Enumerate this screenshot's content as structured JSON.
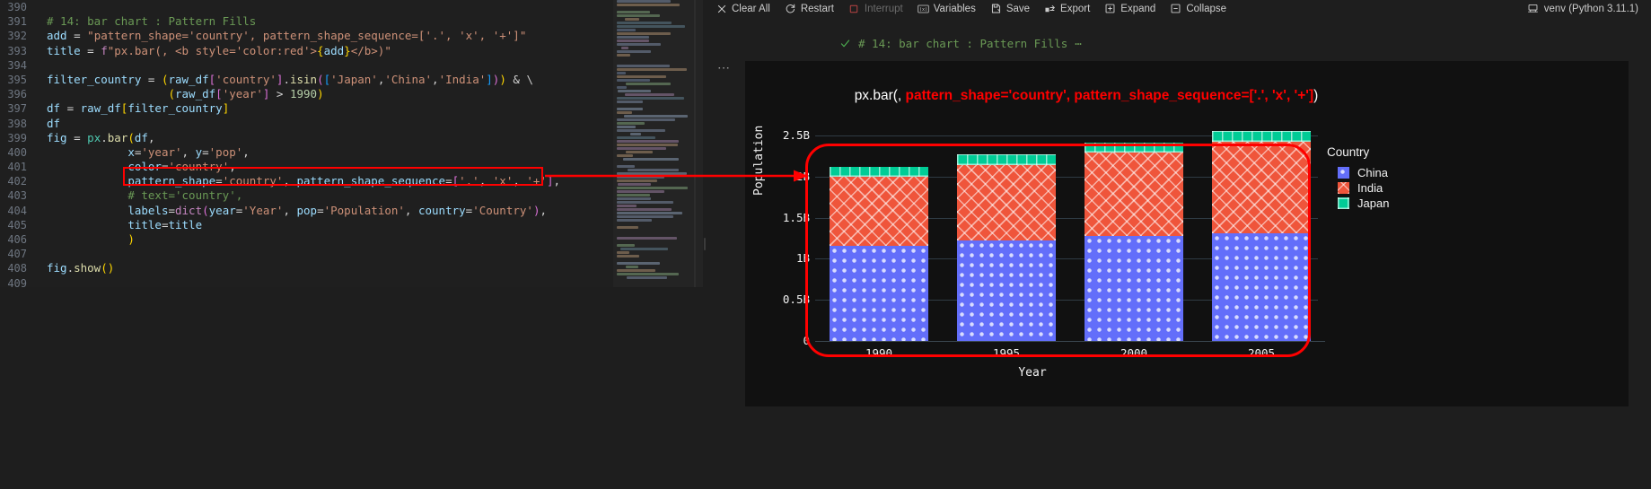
{
  "editor": {
    "lines": [
      {
        "num": "390",
        "tokens": []
      },
      {
        "num": "391",
        "tokens": [
          {
            "t": "# 14: bar chart : Pattern Fills",
            "c": "tk-com"
          }
        ]
      },
      {
        "num": "392",
        "tokens": [
          {
            "t": "add ",
            "c": "tk-var"
          },
          {
            "t": "= ",
            "c": "tk-op"
          },
          {
            "t": "\"pattern_shape='country', pattern_shape_sequence=['.', 'x', '+']\"",
            "c": "tk-str"
          }
        ]
      },
      {
        "num": "393",
        "tokens": [
          {
            "t": "title ",
            "c": "tk-var"
          },
          {
            "t": "= ",
            "c": "tk-op"
          },
          {
            "t": "f",
            "c": "tk-kw"
          },
          {
            "t": "\"px.bar(, <b style='color:red'>",
            "c": "tk-str"
          },
          {
            "t": "{",
            "c": "tk-brk1"
          },
          {
            "t": "add",
            "c": "tk-var"
          },
          {
            "t": "}",
            "c": "tk-brk1"
          },
          {
            "t": "</b>)\"",
            "c": "tk-str"
          }
        ]
      },
      {
        "num": "394",
        "tokens": []
      },
      {
        "num": "395",
        "tokens": [
          {
            "t": "filter_country ",
            "c": "tk-var"
          },
          {
            "t": "= ",
            "c": "tk-op"
          },
          {
            "t": "(",
            "c": "tk-brk1"
          },
          {
            "t": "raw_df",
            "c": "tk-var"
          },
          {
            "t": "[",
            "c": "tk-brk2"
          },
          {
            "t": "'country'",
            "c": "tk-str"
          },
          {
            "t": "]",
            "c": "tk-brk2"
          },
          {
            "t": ".",
            "c": "tk-op"
          },
          {
            "t": "isin",
            "c": "tk-fn"
          },
          {
            "t": "(",
            "c": "tk-brk2"
          },
          {
            "t": "[",
            "c": "tk-brk3"
          },
          {
            "t": "'Japan'",
            "c": "tk-str"
          },
          {
            "t": ",",
            "c": "tk-op"
          },
          {
            "t": "'China'",
            "c": "tk-str"
          },
          {
            "t": ",",
            "c": "tk-op"
          },
          {
            "t": "'India'",
            "c": "tk-str"
          },
          {
            "t": "]",
            "c": "tk-brk3"
          },
          {
            "t": ")",
            "c": "tk-brk2"
          },
          {
            "t": ")",
            "c": "tk-brk1"
          },
          {
            "t": " & ",
            "c": "tk-op"
          },
          {
            "t": "\\",
            "c": "tk-plain"
          }
        ]
      },
      {
        "num": "396",
        "tokens": [
          {
            "t": "                  ",
            "c": "tk-plain"
          },
          {
            "t": "(",
            "c": "tk-brk1"
          },
          {
            "t": "raw_df",
            "c": "tk-var"
          },
          {
            "t": "[",
            "c": "tk-brk2"
          },
          {
            "t": "'year'",
            "c": "tk-str"
          },
          {
            "t": "]",
            "c": "tk-brk2"
          },
          {
            "t": " > ",
            "c": "tk-op"
          },
          {
            "t": "1990",
            "c": "tk-num"
          },
          {
            "t": ")",
            "c": "tk-brk1"
          }
        ]
      },
      {
        "num": "397",
        "tokens": [
          {
            "t": "df ",
            "c": "tk-var"
          },
          {
            "t": "= ",
            "c": "tk-op"
          },
          {
            "t": "raw_df",
            "c": "tk-var"
          },
          {
            "t": "[",
            "c": "tk-brk1"
          },
          {
            "t": "filter_country",
            "c": "tk-var"
          },
          {
            "t": "]",
            "c": "tk-brk1"
          }
        ]
      },
      {
        "num": "398",
        "tokens": [
          {
            "t": "df",
            "c": "tk-var"
          }
        ]
      },
      {
        "num": "399",
        "tokens": [
          {
            "t": "fig ",
            "c": "tk-var"
          },
          {
            "t": "= ",
            "c": "tk-op"
          },
          {
            "t": "px",
            "c": "tk-obj"
          },
          {
            "t": ".",
            "c": "tk-op"
          },
          {
            "t": "bar",
            "c": "tk-fn"
          },
          {
            "t": "(",
            "c": "tk-brk1"
          },
          {
            "t": "df",
            "c": "tk-var"
          },
          {
            "t": ",",
            "c": "tk-op"
          }
        ]
      },
      {
        "num": "400",
        "tokens": [
          {
            "t": "            ",
            "c": "tk-plain"
          },
          {
            "t": "x",
            "c": "tk-var"
          },
          {
            "t": "=",
            "c": "tk-op"
          },
          {
            "t": "'year'",
            "c": "tk-str"
          },
          {
            "t": ", ",
            "c": "tk-op"
          },
          {
            "t": "y",
            "c": "tk-var"
          },
          {
            "t": "=",
            "c": "tk-op"
          },
          {
            "t": "'pop'",
            "c": "tk-str"
          },
          {
            "t": ",",
            "c": "tk-op"
          }
        ]
      },
      {
        "num": "401",
        "tokens": [
          {
            "t": "            ",
            "c": "tk-plain"
          },
          {
            "t": "color",
            "c": "tk-var"
          },
          {
            "t": "=",
            "c": "tk-op"
          },
          {
            "t": "'country'",
            "c": "tk-str"
          },
          {
            "t": ",",
            "c": "tk-op"
          }
        ]
      },
      {
        "num": "402",
        "tokens": [
          {
            "t": "            ",
            "c": "tk-plain"
          },
          {
            "t": "pattern_shape",
            "c": "tk-var"
          },
          {
            "t": "=",
            "c": "tk-op"
          },
          {
            "t": "'country'",
            "c": "tk-str"
          },
          {
            "t": ", ",
            "c": "tk-op"
          },
          {
            "t": "pattern_shape_sequence",
            "c": "tk-var"
          },
          {
            "t": "=",
            "c": "tk-op"
          },
          {
            "t": "[",
            "c": "tk-brk2"
          },
          {
            "t": "'.'",
            "c": "tk-str"
          },
          {
            "t": ", ",
            "c": "tk-op"
          },
          {
            "t": "'x'",
            "c": "tk-str"
          },
          {
            "t": ", ",
            "c": "tk-op"
          },
          {
            "t": "'+'",
            "c": "tk-str"
          },
          {
            "t": "]",
            "c": "tk-brk2"
          },
          {
            "t": ",",
            "c": "tk-op"
          }
        ]
      },
      {
        "num": "403",
        "tokens": [
          {
            "t": "            ",
            "c": "tk-plain"
          },
          {
            "t": "# text='country',",
            "c": "tk-com"
          }
        ]
      },
      {
        "num": "404",
        "tokens": [
          {
            "t": "            ",
            "c": "tk-plain"
          },
          {
            "t": "labels",
            "c": "tk-var"
          },
          {
            "t": "=",
            "c": "tk-op"
          },
          {
            "t": "dict",
            "c": "tk-kw"
          },
          {
            "t": "(",
            "c": "tk-brk2"
          },
          {
            "t": "year",
            "c": "tk-var"
          },
          {
            "t": "=",
            "c": "tk-op"
          },
          {
            "t": "'Year'",
            "c": "tk-str"
          },
          {
            "t": ", ",
            "c": "tk-op"
          },
          {
            "t": "pop",
            "c": "tk-var"
          },
          {
            "t": "=",
            "c": "tk-op"
          },
          {
            "t": "'Population'",
            "c": "tk-str"
          },
          {
            "t": ", ",
            "c": "tk-op"
          },
          {
            "t": "country",
            "c": "tk-var"
          },
          {
            "t": "=",
            "c": "tk-op"
          },
          {
            "t": "'Country'",
            "c": "tk-str"
          },
          {
            "t": ")",
            "c": "tk-brk2"
          },
          {
            "t": ",",
            "c": "tk-op"
          }
        ]
      },
      {
        "num": "405",
        "tokens": [
          {
            "t": "            ",
            "c": "tk-plain"
          },
          {
            "t": "title",
            "c": "tk-var"
          },
          {
            "t": "=",
            "c": "tk-op"
          },
          {
            "t": "title",
            "c": "tk-var"
          }
        ]
      },
      {
        "num": "406",
        "tokens": [
          {
            "t": "            ",
            "c": "tk-plain"
          },
          {
            "t": ")",
            "c": "tk-brk1"
          }
        ]
      },
      {
        "num": "407",
        "tokens": []
      },
      {
        "num": "408",
        "tokens": [
          {
            "t": "fig",
            "c": "tk-var"
          },
          {
            "t": ".",
            "c": "tk-op"
          },
          {
            "t": "show",
            "c": "tk-fn"
          },
          {
            "t": "(",
            "c": "tk-brk1"
          },
          {
            "t": ")",
            "c": "tk-brk1"
          }
        ]
      },
      {
        "num": "409",
        "tokens": []
      }
    ]
  },
  "toolbar": {
    "items": [
      {
        "label": "Clear All",
        "icon": "close-icon",
        "enabled": true
      },
      {
        "label": "Restart",
        "icon": "restart-icon",
        "enabled": true
      },
      {
        "label": "Interrupt",
        "icon": "stop-square-icon",
        "enabled": false
      },
      {
        "label": "Variables",
        "icon": "variables-icon",
        "enabled": true
      },
      {
        "label": "Save",
        "icon": "save-icon",
        "enabled": true
      },
      {
        "label": "Export",
        "icon": "export-icon",
        "enabled": true
      },
      {
        "label": "Expand",
        "icon": "expand-icon",
        "enabled": true
      },
      {
        "label": "Collapse",
        "icon": "collapse-icon",
        "enabled": true
      }
    ],
    "kernel": "venv (Python 3.11.1)",
    "kernel_icon": "kernel-icon"
  },
  "cell": {
    "status_icon": "check-icon",
    "status_text": "# 14: bar chart : Pattern Fills",
    "overflow_ellipsis": "⋯",
    "gutter_dots": "⋯"
  },
  "chart_data": {
    "type": "bar",
    "barmode": "stack",
    "title_plain": "px.bar(, ",
    "title_highlight": "pattern_shape='country', pattern_shape_sequence=['.', 'x', '+']",
    "title_tail": ")",
    "xlabel": "Year",
    "ylabel": "Population",
    "categories": [
      "1990",
      "1995",
      "2000",
      "2005"
    ],
    "ylim": [
      0,
      2750000000
    ],
    "ytick_labels": [
      "2.5B",
      "2B",
      "1.5B",
      "1B",
      "0.5B",
      "0"
    ],
    "ytick_values": [
      2500000000,
      2000000000,
      1500000000,
      1000000000,
      500000000,
      0
    ],
    "grid": true,
    "legend_title": "Country",
    "legend_position": "right",
    "series": [
      {
        "name": "China",
        "color": "#636efa",
        "pattern": ".",
        "values": [
          1155000000,
          1217000000,
          1280000000,
          1312000000
        ]
      },
      {
        "name": "India",
        "color": "#ef553b",
        "pattern": "x",
        "values": [
          838000000,
          927000000,
          1010000000,
          1110000000
        ]
      },
      {
        "name": "Japan",
        "color": "#00cc96",
        "pattern": "+",
        "values": [
          123000000,
          125000000,
          127000000,
          127000000
        ]
      }
    ]
  },
  "annotations": {
    "code_highlight_box": "red-rectangle-line-402",
    "arrow": "red-arrow-to-chart",
    "chart_oval": "red-rounded-rectangle-around-plot",
    "color": "#ff0000"
  }
}
